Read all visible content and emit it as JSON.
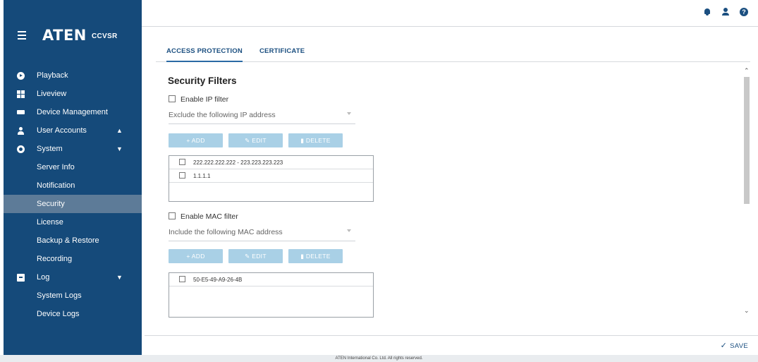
{
  "brand": {
    "logo": "ATEN",
    "product": "CCVSR"
  },
  "sidebar": {
    "items": [
      {
        "label": "Playback"
      },
      {
        "label": "Liveview"
      },
      {
        "label": "Device Management"
      },
      {
        "label": "User Accounts",
        "chevron": "^"
      },
      {
        "label": "System",
        "chevron": "v"
      }
    ],
    "system_sub": [
      {
        "label": "Server Info"
      },
      {
        "label": "Notification"
      },
      {
        "label": "Security",
        "active": true
      },
      {
        "label": "License"
      },
      {
        "label": "Backup & Restore"
      },
      {
        "label": "Recording"
      }
    ],
    "log": {
      "label": "Log",
      "chevron": "v"
    },
    "log_sub": [
      {
        "label": "System Logs"
      },
      {
        "label": "Device Logs"
      }
    ]
  },
  "topbar": {
    "help_glyph": "?"
  },
  "tabs": [
    {
      "label": "ACCESS PROTECTION",
      "active": true
    },
    {
      "label": "CERTIFICATE",
      "active": false
    }
  ],
  "security": {
    "title": "Security Filters",
    "ip": {
      "enable_label": "Enable IP filter",
      "mode": "Exclude the following IP address",
      "buttons": {
        "add": "+ ADD",
        "edit": "EDIT",
        "delete": "DELETE"
      },
      "entries": [
        "222.222.222.222 - 223.223.223.223",
        "1.1.1.1"
      ]
    },
    "mac": {
      "enable_label": "Enable MAC filter",
      "mode": "Include the following MAC address",
      "buttons": {
        "add": "+ ADD",
        "edit": "EDIT",
        "delete": "DELETE"
      },
      "entries": [
        "50-E5-49-A9-26-4B"
      ]
    }
  },
  "save": {
    "label": "SAVE"
  },
  "footer": {
    "text": "ATEN International Co. Ltd. All rights reserved."
  }
}
